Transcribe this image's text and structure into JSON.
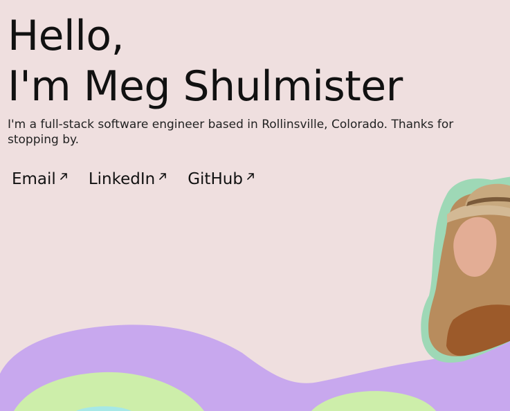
{
  "hero": {
    "greeting_line1": "Hello,",
    "greeting_line2": "I'm Meg Shulmister",
    "intro": "I'm a full-stack software engineer based in Rollinsville, Colorado. Thanks for stopping by."
  },
  "links": [
    {
      "label": "Email",
      "icon": "external-arrow-icon"
    },
    {
      "label": "LinkedIn",
      "icon": "external-arrow-icon"
    },
    {
      "label": "GitHub",
      "icon": "external-arrow-icon"
    }
  ],
  "colors": {
    "background": "#efdfdf",
    "blob_purple": "#c8a8ee",
    "blob_green": "#cdeeaa",
    "blob_teal": "#a6e8e6",
    "portrait_outline": "#9ed8b6"
  }
}
